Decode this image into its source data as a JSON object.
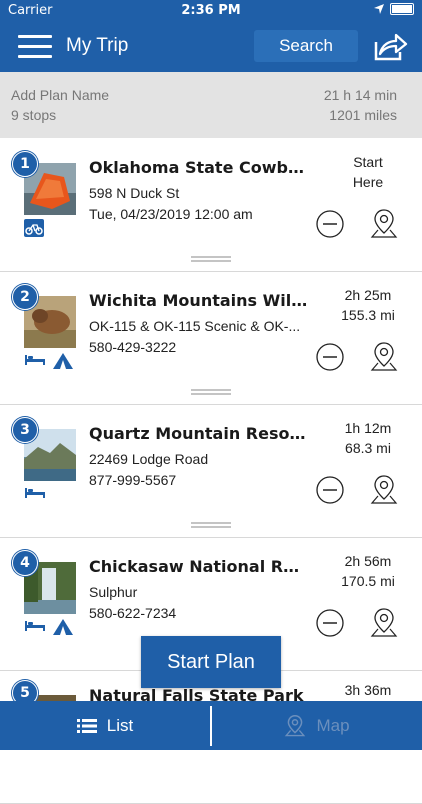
{
  "status_bar": {
    "carrier": "Carrier",
    "time": "2:36 PM"
  },
  "nav": {
    "title": "My Trip",
    "search_label": "Search"
  },
  "plan": {
    "name_placeholder": "Add Plan Name",
    "stops": "9 stops",
    "duration": "21 h 14 min",
    "distance": "1201 miles"
  },
  "stops": [
    {
      "number": "1",
      "name": "Oklahoma State Cowboy...",
      "address": "598 N Duck St",
      "detail": "Tue, 04/23/2019 12:00 am",
      "time_top": "Start",
      "time_bottom": "Here",
      "amenities": [
        "bike-icon"
      ]
    },
    {
      "number": "2",
      "name": "Wichita Mountains Wildl...",
      "address": "OK-115 & OK-115 Scenic & OK-...",
      "detail": "580-429-3222",
      "time_top": "2h 25m",
      "time_bottom": "155.3 mi",
      "amenities": [
        "bed-icon",
        "tent-icon"
      ]
    },
    {
      "number": "3",
      "name": "Quartz Mountain Resort...",
      "address": "22469 Lodge Road",
      "detail": "877-999-5567",
      "time_top": "1h 12m",
      "time_bottom": "68.3 mi",
      "amenities": [
        "bed-icon"
      ]
    },
    {
      "number": "4",
      "name": "Chickasaw National Rec...",
      "address": "Sulphur",
      "detail": "580-622-7234",
      "time_top": "2h 56m",
      "time_bottom": "170.5 mi",
      "amenities": [
        "bed-icon",
        "tent-icon"
      ]
    },
    {
      "number": "5",
      "name": "Natural Falls State Park",
      "address": "",
      "detail": "",
      "time_top": "3h 36m",
      "time_bottom": "",
      "amenities": []
    }
  ],
  "start_plan_label": "Start Plan",
  "tabs": {
    "list": "List",
    "map": "Map"
  },
  "colors": {
    "primary": "#1f5fa8",
    "plan_bar": "#e3e3e3"
  }
}
